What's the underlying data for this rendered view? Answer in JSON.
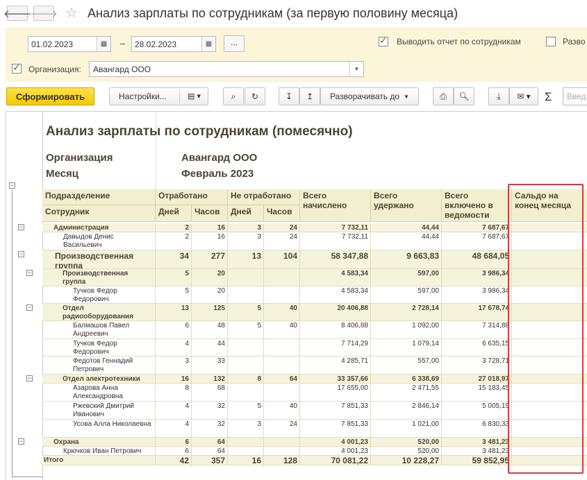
{
  "window": {
    "title": "Анализ зарплаты по сотрудникам (за первую половину месяца)"
  },
  "settings": {
    "date_from": "01.02.2023",
    "date_to": "28.02.2023",
    "dash": "–",
    "dots": "...",
    "by_employee_label": "Выводить отчет по сотрудникам",
    "expand_label": "Разво",
    "org_label": "Организация:",
    "org_value": "Авангард ООО"
  },
  "toolbar": {
    "generate": "Сформировать",
    "settings": "Настройки...",
    "expand_to": "Разворачивать до",
    "sigma": "Σ",
    "search_placeholder": "Введ"
  },
  "report": {
    "title": "Анализ зарплаты по сотрудникам (помесячно)",
    "org_label": "Организация",
    "org_value": "Авангард ООО",
    "month_label": "Месяц",
    "month_value": "Февраль 2023",
    "headers": {
      "department": "Подразделение",
      "employee": "Сотрудник",
      "worked": "Отработано",
      "not_worked": "Не отработано",
      "days": "Дней",
      "hours": "Часов",
      "accrued": "Всего начислено",
      "withheld": "Всего удержано",
      "in_statement": "Всего включено в ведомости",
      "balance": "Сальдо на конец месяца"
    },
    "rows": [
      {
        "name": "Администрация",
        "type": "grp",
        "d": "2",
        "h": "16",
        "nd": "3",
        "nh": "24",
        "acc": "7 732,11",
        "wh": "44,44",
        "st": "7 687,67"
      },
      {
        "name": "Давыдов Денис Васильевич",
        "type": "emp",
        "d": "2",
        "h": "16",
        "nd": "3",
        "nh": "24",
        "acc": "7 732,11",
        "wh": "44,44",
        "st": "7 687,67"
      },
      {
        "name": "Производственная группа",
        "type": "grp-big",
        "d": "34",
        "h": "277",
        "nd": "13",
        "nh": "104",
        "acc": "58 347,88",
        "wh": "9 663,83",
        "st": "48 684,05"
      },
      {
        "name": "Производственная группа",
        "type": "grp",
        "d": "5",
        "h": "20",
        "nd": "",
        "nh": "",
        "acc": "4 583,34",
        "wh": "597,00",
        "st": "3 986,34"
      },
      {
        "name": "Тучков Федор Федорович",
        "type": "emp",
        "d": "5",
        "h": "20",
        "nd": "",
        "nh": "",
        "acc": "4 583,34",
        "wh": "597,00",
        "st": "3 986,34"
      },
      {
        "name": "Отдел радиооборудования",
        "type": "grp",
        "d": "13",
        "h": "125",
        "nd": "5",
        "nh": "40",
        "acc": "20 406,88",
        "wh": "2 728,14",
        "st": "17 678,74"
      },
      {
        "name": "Балмашов Павел Андреевич",
        "type": "emp",
        "d": "6",
        "h": "48",
        "nd": "5",
        "nh": "40",
        "acc": "8 406,88",
        "wh": "1 092,00",
        "st": "7 314,88"
      },
      {
        "name": "Тучков Федор Федорович",
        "type": "emp",
        "d": "4",
        "h": "44",
        "nd": "",
        "nh": "",
        "acc": "7 714,29",
        "wh": "1 079,14",
        "st": "6 635,15"
      },
      {
        "name": "Федотов Геннадий Петрович",
        "type": "emp",
        "d": "3",
        "h": "33",
        "nd": "",
        "nh": "",
        "acc": "4 285,71",
        "wh": "557,00",
        "st": "3 728,71"
      },
      {
        "name": "Отдел электротехники",
        "type": "grp",
        "d": "16",
        "h": "132",
        "nd": "8",
        "nh": "64",
        "acc": "33 357,66",
        "wh": "6 338,69",
        "st": "27 018,97"
      },
      {
        "name": "Азарова Анна Александровна",
        "type": "emp",
        "d": "8",
        "h": "68",
        "nd": "",
        "nh": "",
        "acc": "17 655,00",
        "wh": "2 471,55",
        "st": "15 183,45"
      },
      {
        "name": "Ржевский Дмитрий Иванович",
        "type": "emp",
        "d": "4",
        "h": "32",
        "nd": "5",
        "nh": "40",
        "acc": "7 851,33",
        "wh": "2 846,14",
        "st": "5 005,19"
      },
      {
        "name": "Усова Алла Николаевна",
        "type": "emp",
        "d": "4",
        "h": "32",
        "nd": "3",
        "nh": "24",
        "acc": "7 851,33",
        "wh": "1 021,00",
        "st": "6 830,33"
      },
      {
        "name": "Охрана",
        "type": "grp",
        "d": "6",
        "h": "64",
        "nd": "",
        "nh": "",
        "acc": "4 001,23",
        "wh": "520,00",
        "st": "3 481,23"
      },
      {
        "name": "Крючков Иван Петрович",
        "type": "emp1",
        "d": "6",
        "h": "64",
        "nd": "",
        "nh": "",
        "acc": "4 001,23",
        "wh": "520,00",
        "st": "3 481,23"
      },
      {
        "name": "Итого",
        "type": "total",
        "d": "42",
        "h": "357",
        "nd": "16",
        "nh": "128",
        "acc": "70 081,22",
        "wh": "10 228,27",
        "st": "59 852,95"
      }
    ]
  },
  "colors": {
    "accent_yellow": "#f5c800",
    "highlight_red": "#d23c3c",
    "panel_bg": "#fbf5d9"
  }
}
